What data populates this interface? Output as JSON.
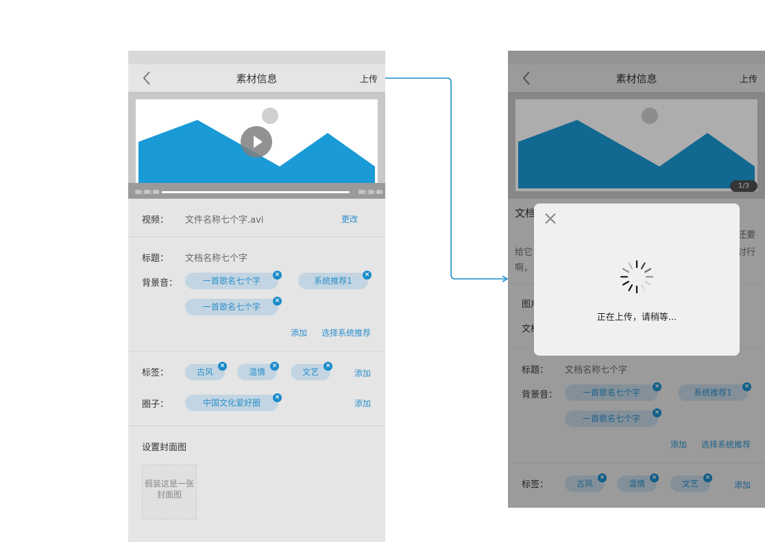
{
  "left_screen": {
    "nav": {
      "title": "素材信息",
      "action": "上传"
    },
    "player": {
      "time_start": "00:00:00",
      "time_end": "00:30:00",
      "progress": 1.0
    },
    "video": {
      "label": "视频：",
      "filename": "文件名称七个字.avi",
      "change": "更改"
    },
    "title_row": {
      "label": "标题：",
      "value": "文档名称七个字"
    },
    "bgm": {
      "label": "背景音：",
      "tags": [
        "一首歌名七个字",
        "系统推荐1",
        "一首歌名七个字"
      ],
      "add": "添加",
      "select_system": "选择系统推荐"
    },
    "tags_row": {
      "label": "标签：",
      "tags": [
        "古风",
        "温情",
        "文艺"
      ],
      "add": "添加"
    },
    "circle_row": {
      "label": "圈子：",
      "tags": [
        "中国文化爱好圈"
      ],
      "add": "添加"
    },
    "cover": {
      "label": "设置封面图",
      "placeholder": "假装这是一张封面图"
    },
    "tag_remove_glyph": "×"
  },
  "right_screen": {
    "nav": {
      "title": "素材信息",
      "action": "上传"
    },
    "pager": "1/3",
    "partial_texts": [
      "文档",
      "还要",
      "给它",
      "讨行",
      "啊，",
      "图片",
      "文档"
    ],
    "title_row": {
      "label": "标题：",
      "value": "文档名称七个字"
    },
    "bgm": {
      "label": "背景音：",
      "tags": [
        "一首歌名七个字",
        "系统推荐1",
        "一首歌名七个字"
      ],
      "add": "添加",
      "select_system": "选择系统推荐"
    },
    "tags_row": {
      "label": "标签：",
      "tags": [
        "古风",
        "温情",
        "文艺"
      ],
      "add": "添加"
    }
  },
  "dialog": {
    "message": "正在上传，请稍等...",
    "close_icon": "close-icon"
  },
  "colors": {
    "accent": "#2a8fcc",
    "mountain": "#1a9ad6",
    "tag_bg": "#c3d5e2",
    "connector": "#1a8bc9"
  }
}
